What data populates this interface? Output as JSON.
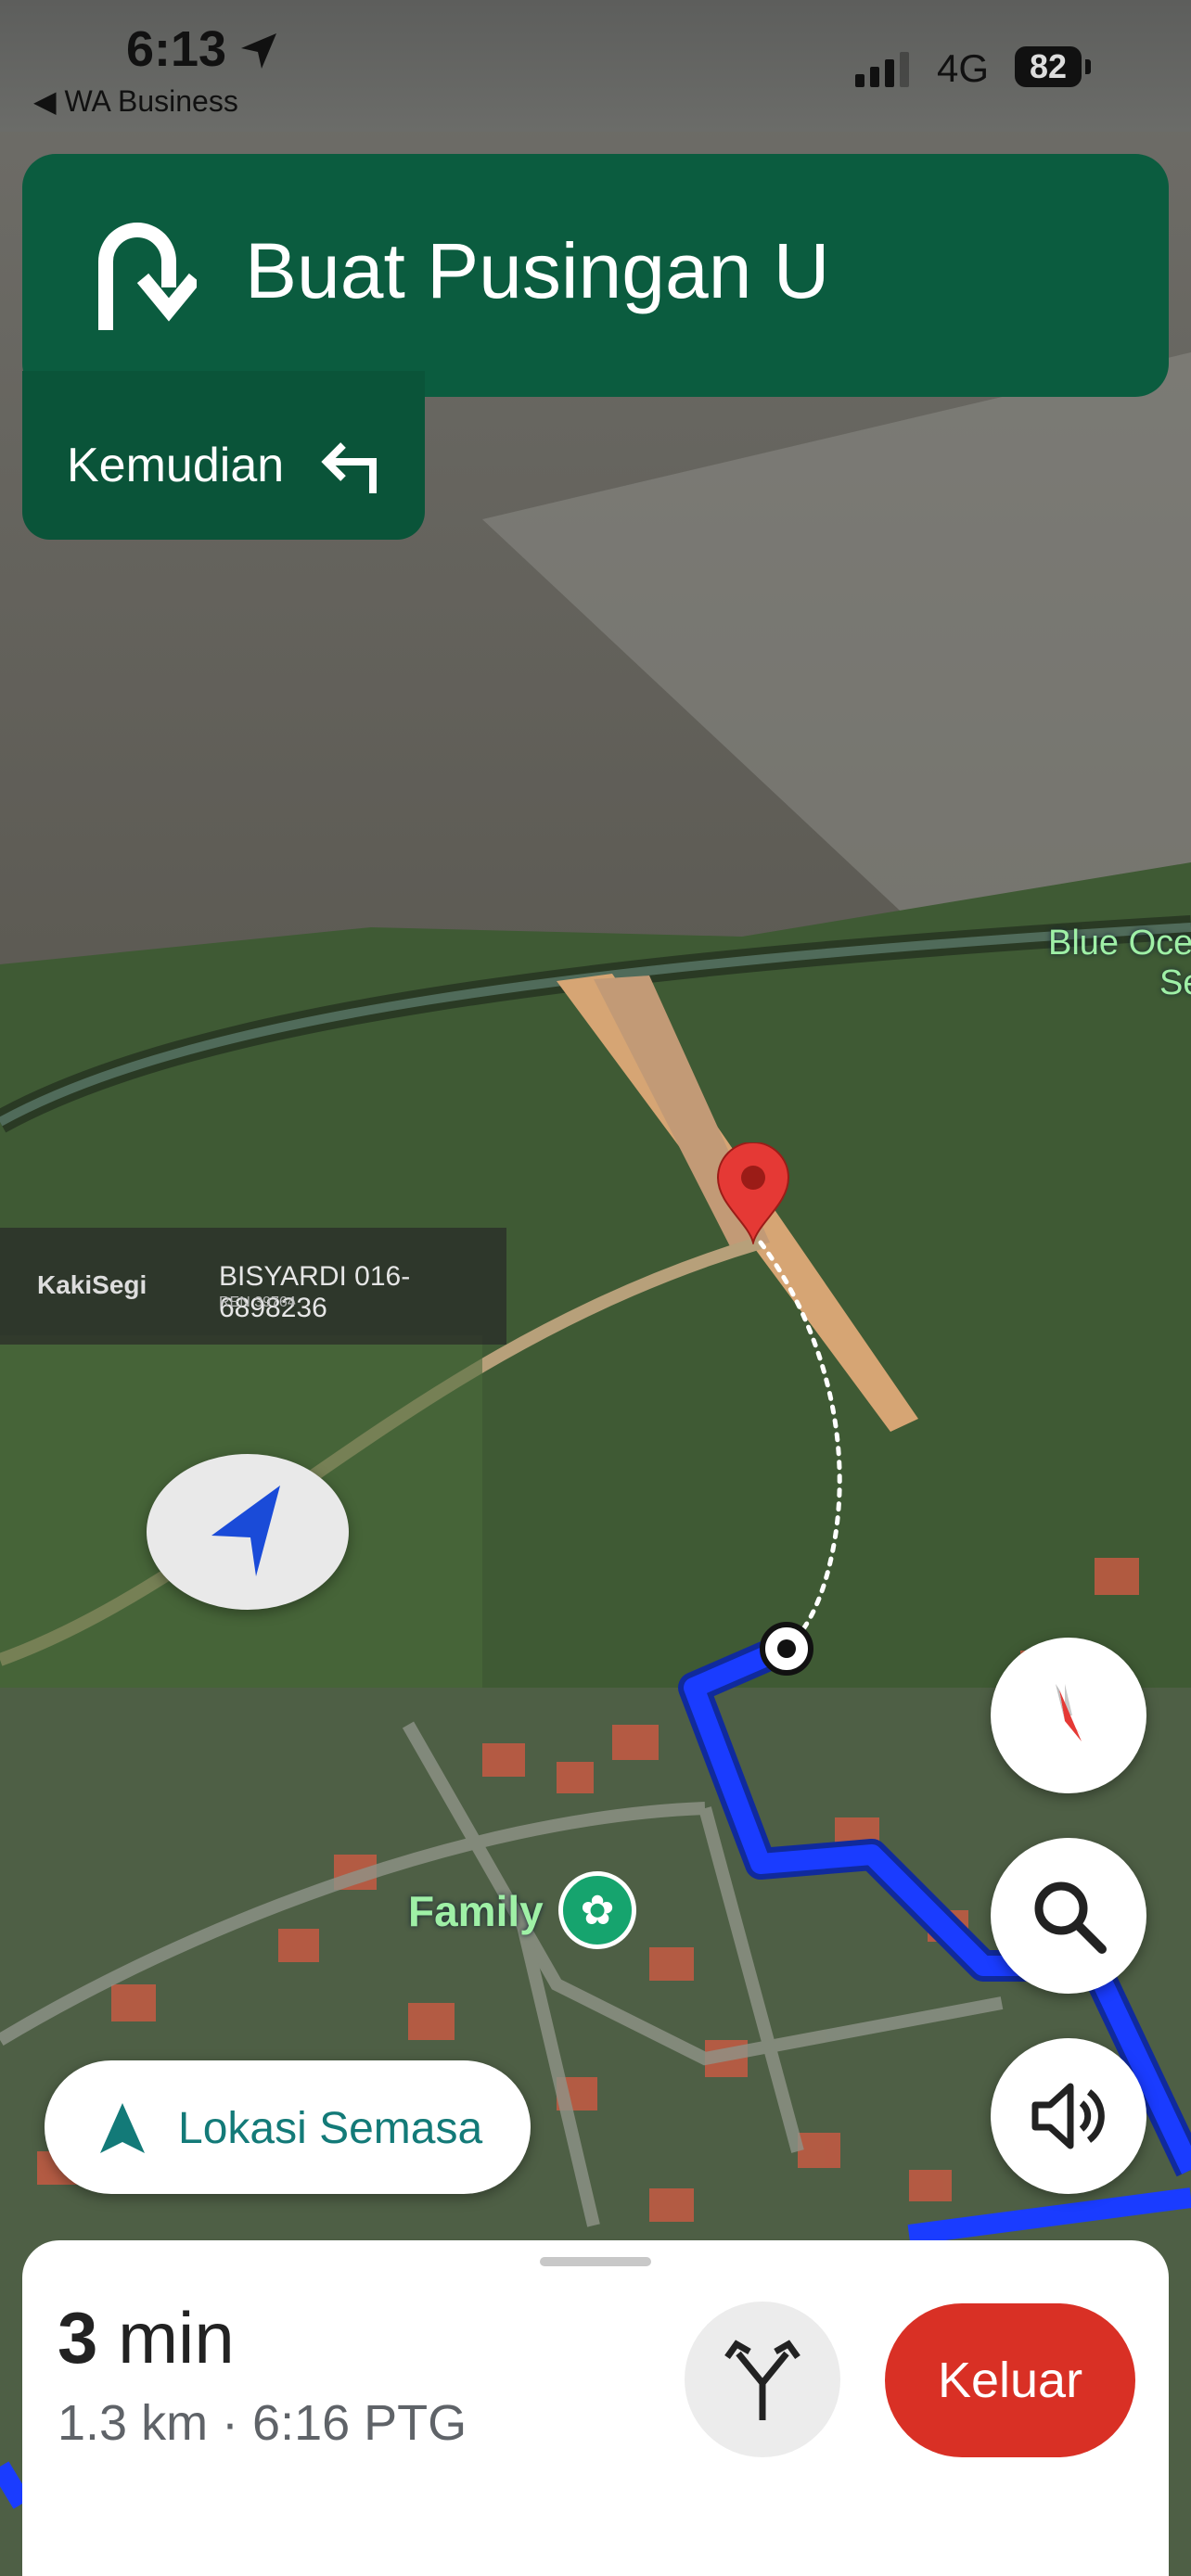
{
  "status_bar": {
    "time": "6:13",
    "back_label": "◀ WA Business",
    "network": "4G",
    "battery": "82"
  },
  "navigation": {
    "instruction": "Buat Pusingan U",
    "instruction_icon": "u-turn-right-icon",
    "then_label": "Kemudian",
    "then_icon": "turn-left-icon"
  },
  "watermark": {
    "brand": "KakiSegi",
    "agent": "BISYARDI 016-6898236",
    "license": "REN 39764"
  },
  "map": {
    "poi_label": "Family",
    "place_label": "Blue Oce",
    "place_label_line2": "Se"
  },
  "controls": {
    "current_location_label": "Lokasi Semasa",
    "compass_icon": "compass-icon",
    "search_icon": "search-icon",
    "sound_icon": "volume-icon",
    "recenter_icon": "navigation-arrow-icon"
  },
  "trip": {
    "eta_value": "3",
    "eta_unit": "min",
    "summary": "1.3 km · 6:16 PTG",
    "exit_label": "Keluar",
    "routes_icon": "alternate-routes-icon"
  },
  "colors": {
    "banner": "#0b5c3f",
    "route": "#1a3cff",
    "exit": "#d93025",
    "accent": "#137a78"
  }
}
